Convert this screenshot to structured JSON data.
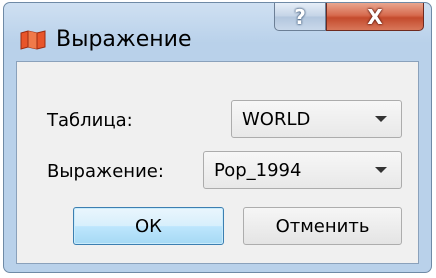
{
  "window": {
    "title": "Выражение",
    "help_label": "?",
    "close_label": "X"
  },
  "form": {
    "table_label": "Таблица:",
    "table_value": "WORLD",
    "expression_label": "Выражение:",
    "expression_value": "Pop_1994"
  },
  "buttons": {
    "ok_label": "ОК",
    "cancel_label": "Отменить"
  },
  "icons": {
    "app": "map-icon",
    "dropdown": "chevron-down-icon"
  },
  "colors": {
    "title_bar": "#b9d1ea",
    "close_button": "#c44b2d",
    "client_bg": "#f0f0f0",
    "default_button_border": "#3c7fb1"
  }
}
